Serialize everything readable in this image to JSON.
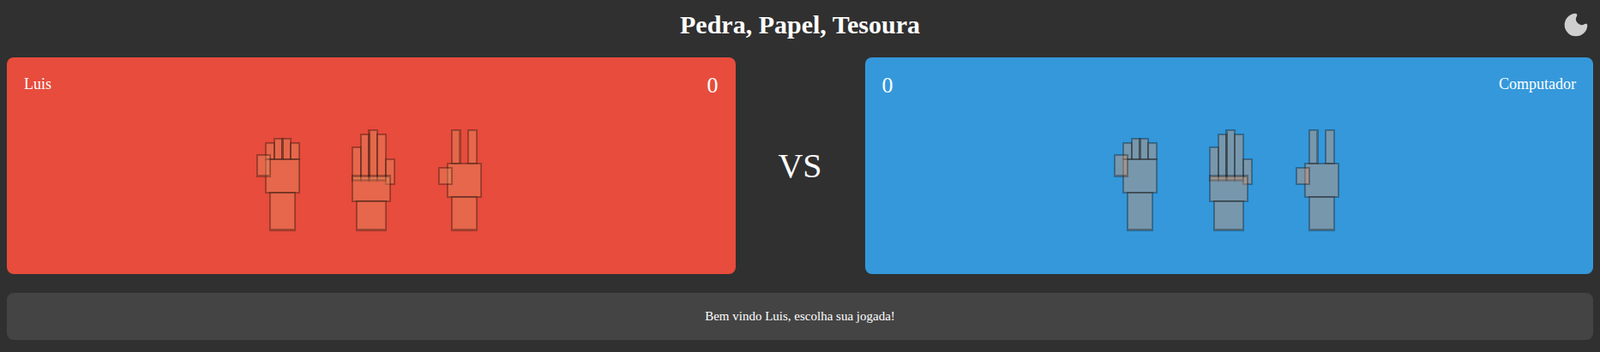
{
  "title": "Pedra, Papel, Tesoura",
  "players": [
    {
      "name": "Luis",
      "score": "0",
      "side": "left",
      "color": "#e74c3c",
      "hands": [
        {
          "kind": "rock",
          "selected": false
        },
        {
          "kind": "paper",
          "selected": false
        },
        {
          "kind": "scissors",
          "selected": false
        }
      ]
    },
    {
      "name": "Computador",
      "score": "0",
      "side": "right",
      "color": "#3498db",
      "hands": [
        {
          "kind": "rock",
          "selected": false
        },
        {
          "kind": "paper",
          "selected": false
        },
        {
          "kind": "scissors",
          "selected": false
        }
      ]
    }
  ],
  "versus": "VS",
  "message": "Bem vindo Luis, escolha sua jogada!"
}
